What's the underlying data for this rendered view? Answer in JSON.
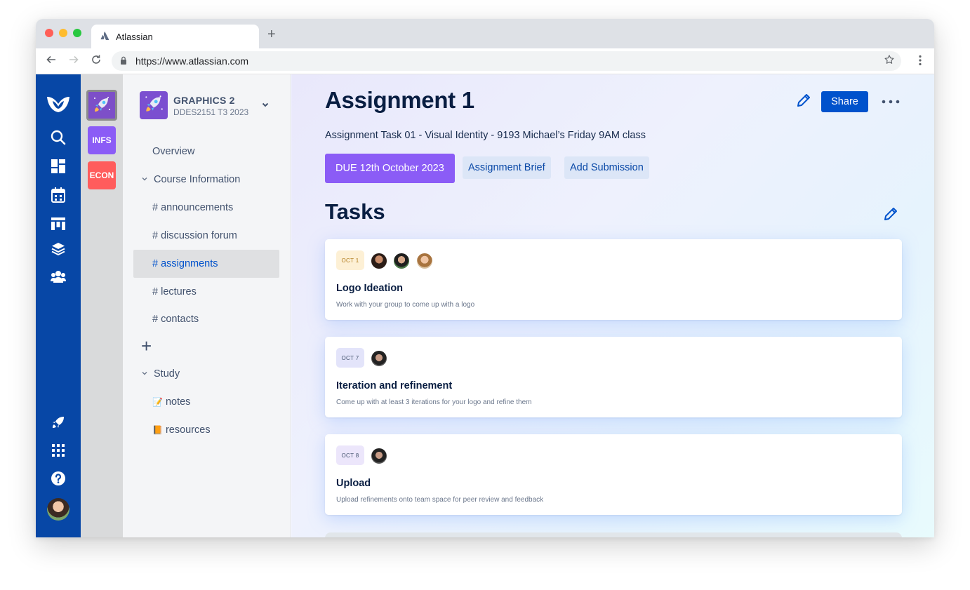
{
  "browser": {
    "tab_title": "Atlassian",
    "new_tab": "+",
    "url": "https://www.atlassian.com"
  },
  "spaces": [
    {
      "label": "",
      "color": "#7d4fc8",
      "active": true
    },
    {
      "label": "INFS",
      "color": "#8b5cf6"
    },
    {
      "label": "ECON",
      "color": "#ff5c5c"
    }
  ],
  "sidebar": {
    "project_title": "GRAPHICS 2",
    "project_subtitle": "DDES2151 T3 2023",
    "overview": "Overview",
    "group_course": "Course Information",
    "items": [
      {
        "label": "# announcements"
      },
      {
        "label": "# discussion forum"
      },
      {
        "label": "# assignments"
      },
      {
        "label": "# lectures"
      },
      {
        "label": "# contacts"
      }
    ],
    "add": "+",
    "group_study": "Study",
    "study_items": [
      {
        "emoji": "📝",
        "label": "notes"
      },
      {
        "emoji": "📙",
        "label": "resources"
      }
    ]
  },
  "main": {
    "title": "Assignment 1",
    "share": "Share",
    "more": "• • •",
    "subtitle": "Assignment Task 01 - Visual Identity - 9193 Michael’s Friday 9AM class",
    "due": "DUE 12th October 2023",
    "brief": "Assignment Brief",
    "add_submission": "Add Submission",
    "tasks_heading": "Tasks",
    "tasks": [
      {
        "date": "OCT 1",
        "badge_bg": "#fdf0d5",
        "badge_fg": "#b07a1a",
        "title": "Logo Ideation",
        "desc": "Work with your group to come up with a logo"
      },
      {
        "date": "OCT 7",
        "badge_bg": "#e3e4fa",
        "badge_fg": "#42526e",
        "title": "Iteration and refinement",
        "desc": "Come up with at least 3 iterations for your logo and refine them"
      },
      {
        "date": "OCT 8",
        "badge_bg": "#ece6fb",
        "badge_fg": "#42526e",
        "title": "Upload",
        "desc": "Upload refinements onto team space for peer review and feedback"
      }
    ]
  },
  "colors": {
    "rail": "#0747a6",
    "primary": "#0052cc",
    "due": "#8b5cf6"
  }
}
